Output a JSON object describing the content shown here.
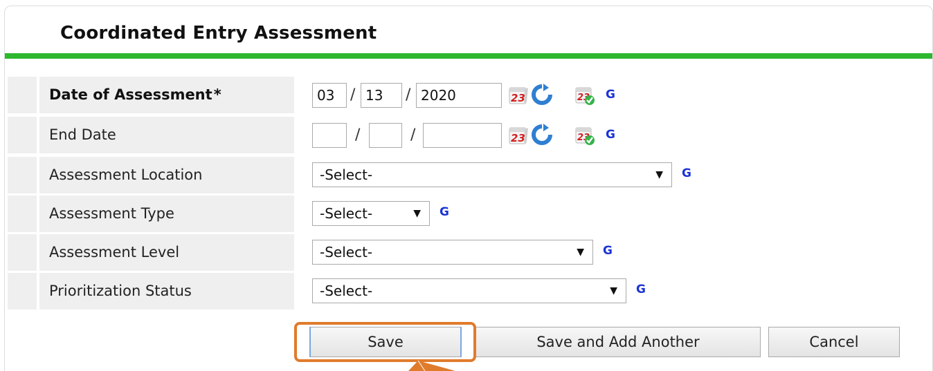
{
  "panel": {
    "title": "Coordinated Entry Assessment"
  },
  "fields": {
    "date_of_assessment": {
      "label": "Date of Assessment",
      "required_mark": "*",
      "month": "03",
      "day": "13",
      "year": "2020",
      "g_link": "G"
    },
    "end_date": {
      "label": "End Date",
      "month": "",
      "day": "",
      "year": "",
      "g_link": "G"
    },
    "assessment_location": {
      "label": "Assessment Location",
      "value": "-Select-",
      "g_link": "G"
    },
    "assessment_type": {
      "label": "Assessment Type",
      "value": "-Select-",
      "g_link": "G"
    },
    "assessment_level": {
      "label": "Assessment Level",
      "value": "-Select-",
      "g_link": "G"
    },
    "prioritization_status": {
      "label": "Prioritization Status",
      "value": "-Select-",
      "g_link": "G"
    }
  },
  "date_separator": "/",
  "dropdown_arrow": "▼",
  "buttons": {
    "save": "Save",
    "save_and_add": "Save and Add Another",
    "cancel": "Cancel"
  },
  "icons": {
    "calendar": "calendar-icon",
    "refresh": "refresh-icon",
    "calendar_check": "calendar-check-icon"
  },
  "colors": {
    "accent_green": "#2fb72f",
    "highlight_orange": "#e07b2c",
    "link_blue": "#1a33d6"
  }
}
